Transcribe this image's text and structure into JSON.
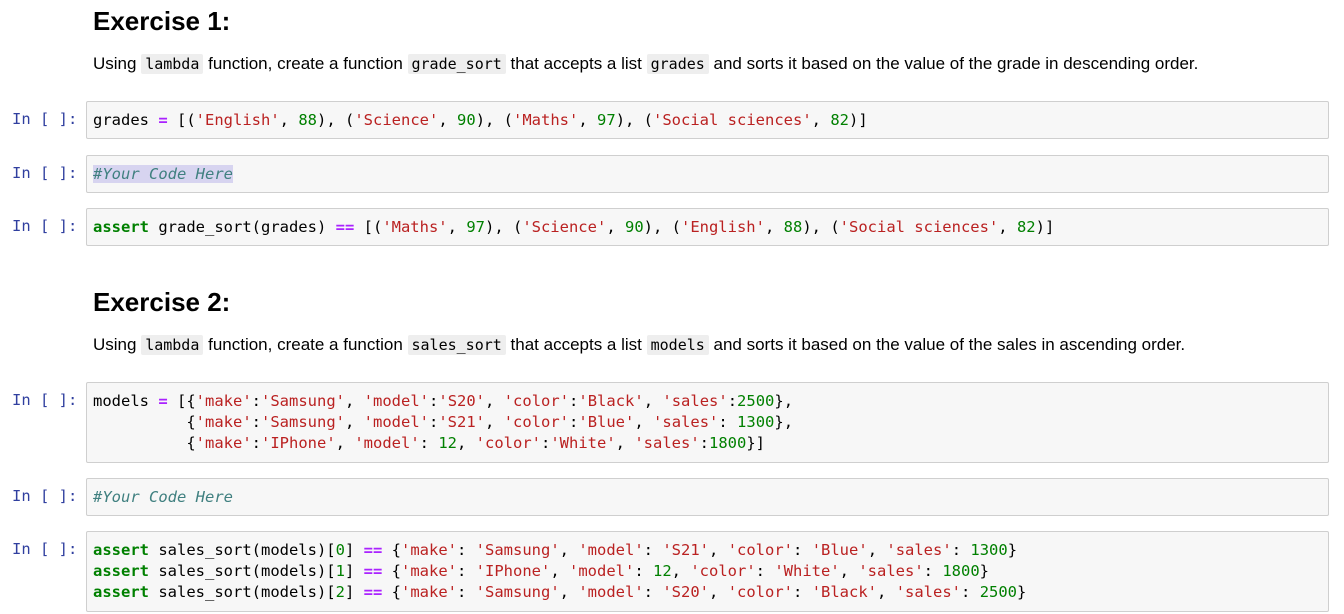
{
  "exercise1": {
    "heading": "Exercise 1:",
    "desc_a": "Using ",
    "desc_code1": "lambda",
    "desc_b": " function, create a function ",
    "desc_code2": "grade_sort",
    "desc_c": " that accepts a list ",
    "desc_code3": "grades",
    "desc_d": " and sorts it based on the value of the grade in descending order.",
    "cells": [
      {
        "prompt": "In [ ]:",
        "lines": [
          [
            [
              "t",
              "grades "
            ],
            [
              "op",
              "="
            ],
            [
              "t",
              " [("
            ],
            [
              "str",
              "'English'"
            ],
            [
              "t",
              ", "
            ],
            [
              "num",
              "88"
            ],
            [
              "t",
              "), ("
            ],
            [
              "str",
              "'Science'"
            ],
            [
              "t",
              ", "
            ],
            [
              "num",
              "90"
            ],
            [
              "t",
              "), ("
            ],
            [
              "str",
              "'Maths'"
            ],
            [
              "t",
              ", "
            ],
            [
              "num",
              "97"
            ],
            [
              "t",
              "), ("
            ],
            [
              "str",
              "'Social sciences'"
            ],
            [
              "t",
              ", "
            ],
            [
              "num",
              "82"
            ],
            [
              "t",
              ")]"
            ]
          ]
        ]
      },
      {
        "prompt": "In [ ]:",
        "lines": [
          [
            [
              "comsel",
              "#Your Code Here"
            ]
          ]
        ]
      },
      {
        "prompt": "In [ ]:",
        "lines": [
          [
            [
              "kw",
              "assert"
            ],
            [
              "t",
              " grade_sort(grades) "
            ],
            [
              "op",
              "=="
            ],
            [
              "t",
              " [("
            ],
            [
              "str",
              "'Maths'"
            ],
            [
              "t",
              ", "
            ],
            [
              "num",
              "97"
            ],
            [
              "t",
              "), ("
            ],
            [
              "str",
              "'Science'"
            ],
            [
              "t",
              ", "
            ],
            [
              "num",
              "90"
            ],
            [
              "t",
              "), ("
            ],
            [
              "str",
              "'English'"
            ],
            [
              "t",
              ", "
            ],
            [
              "num",
              "88"
            ],
            [
              "t",
              "), ("
            ],
            [
              "str",
              "'Social sciences'"
            ],
            [
              "t",
              ", "
            ],
            [
              "num",
              "82"
            ],
            [
              "t",
              ")]"
            ]
          ]
        ]
      }
    ]
  },
  "exercise2": {
    "heading": "Exercise 2:",
    "desc_a": "Using ",
    "desc_code1": "lambda",
    "desc_b": " function, create a function ",
    "desc_code2": "sales_sort",
    "desc_c": " that accepts a list ",
    "desc_code3": "models",
    "desc_d": " and sorts it based on the value of the sales in ascending order.",
    "cells": [
      {
        "prompt": "In [ ]:",
        "lines": [
          [
            [
              "t",
              "models "
            ],
            [
              "op",
              "="
            ],
            [
              "t",
              " [{"
            ],
            [
              "str",
              "'make'"
            ],
            [
              "t",
              ":"
            ],
            [
              "str",
              "'Samsung'"
            ],
            [
              "t",
              ", "
            ],
            [
              "str",
              "'model'"
            ],
            [
              "t",
              ":"
            ],
            [
              "str",
              "'S20'"
            ],
            [
              "t",
              ", "
            ],
            [
              "str",
              "'color'"
            ],
            [
              "t",
              ":"
            ],
            [
              "str",
              "'Black'"
            ],
            [
              "t",
              ", "
            ],
            [
              "str",
              "'sales'"
            ],
            [
              "t",
              ":"
            ],
            [
              "num",
              "2500"
            ],
            [
              "t",
              "},"
            ]
          ],
          [
            [
              "t",
              "          {"
            ],
            [
              "str",
              "'make'"
            ],
            [
              "t",
              ":"
            ],
            [
              "str",
              "'Samsung'"
            ],
            [
              "t",
              ", "
            ],
            [
              "str",
              "'model'"
            ],
            [
              "t",
              ":"
            ],
            [
              "str",
              "'S21'"
            ],
            [
              "t",
              ", "
            ],
            [
              "str",
              "'color'"
            ],
            [
              "t",
              ":"
            ],
            [
              "str",
              "'Blue'"
            ],
            [
              "t",
              ", "
            ],
            [
              "str",
              "'sales'"
            ],
            [
              "t",
              ": "
            ],
            [
              "num",
              "1300"
            ],
            [
              "t",
              "},"
            ]
          ],
          [
            [
              "t",
              "          {"
            ],
            [
              "str",
              "'make'"
            ],
            [
              "t",
              ":"
            ],
            [
              "str",
              "'IPhone'"
            ],
            [
              "t",
              ", "
            ],
            [
              "str",
              "'model'"
            ],
            [
              "t",
              ": "
            ],
            [
              "num",
              "12"
            ],
            [
              "t",
              ", "
            ],
            [
              "str",
              "'color'"
            ],
            [
              "t",
              ":"
            ],
            [
              "str",
              "'White'"
            ],
            [
              "t",
              ", "
            ],
            [
              "str",
              "'sales'"
            ],
            [
              "t",
              ":"
            ],
            [
              "num",
              "1800"
            ],
            [
              "t",
              "}]"
            ]
          ]
        ]
      },
      {
        "prompt": "In [ ]:",
        "lines": [
          [
            [
              "com",
              "#Your Code Here"
            ]
          ]
        ]
      },
      {
        "prompt": "In [ ]:",
        "lines": [
          [
            [
              "kw",
              "assert"
            ],
            [
              "t",
              " sales_sort(models)["
            ],
            [
              "num",
              "0"
            ],
            [
              "t",
              "] "
            ],
            [
              "op",
              "=="
            ],
            [
              "t",
              " {"
            ],
            [
              "str",
              "'make'"
            ],
            [
              "t",
              ": "
            ],
            [
              "str",
              "'Samsung'"
            ],
            [
              "t",
              ", "
            ],
            [
              "str",
              "'model'"
            ],
            [
              "t",
              ": "
            ],
            [
              "str",
              "'S21'"
            ],
            [
              "t",
              ", "
            ],
            [
              "str",
              "'color'"
            ],
            [
              "t",
              ": "
            ],
            [
              "str",
              "'Blue'"
            ],
            [
              "t",
              ", "
            ],
            [
              "str",
              "'sales'"
            ],
            [
              "t",
              ": "
            ],
            [
              "num",
              "1300"
            ],
            [
              "t",
              "}"
            ]
          ],
          [
            [
              "kw",
              "assert"
            ],
            [
              "t",
              " sales_sort(models)["
            ],
            [
              "num",
              "1"
            ],
            [
              "t",
              "] "
            ],
            [
              "op",
              "=="
            ],
            [
              "t",
              " {"
            ],
            [
              "str",
              "'make'"
            ],
            [
              "t",
              ": "
            ],
            [
              "str",
              "'IPhone'"
            ],
            [
              "t",
              ", "
            ],
            [
              "str",
              "'model'"
            ],
            [
              "t",
              ": "
            ],
            [
              "num",
              "12"
            ],
            [
              "t",
              ", "
            ],
            [
              "str",
              "'color'"
            ],
            [
              "t",
              ": "
            ],
            [
              "str",
              "'White'"
            ],
            [
              "t",
              ", "
            ],
            [
              "str",
              "'sales'"
            ],
            [
              "t",
              ": "
            ],
            [
              "num",
              "1800"
            ],
            [
              "t",
              "}"
            ]
          ],
          [
            [
              "kw",
              "assert"
            ],
            [
              "t",
              " sales_sort(models)["
            ],
            [
              "num",
              "2"
            ],
            [
              "t",
              "] "
            ],
            [
              "op",
              "=="
            ],
            [
              "t",
              " {"
            ],
            [
              "str",
              "'make'"
            ],
            [
              "t",
              ": "
            ],
            [
              "str",
              "'Samsung'"
            ],
            [
              "t",
              ", "
            ],
            [
              "str",
              "'model'"
            ],
            [
              "t",
              ": "
            ],
            [
              "str",
              "'S20'"
            ],
            [
              "t",
              ", "
            ],
            [
              "str",
              "'color'"
            ],
            [
              "t",
              ": "
            ],
            [
              "str",
              "'Black'"
            ],
            [
              "t",
              ", "
            ],
            [
              "str",
              "'sales'"
            ],
            [
              "t",
              ": "
            ],
            [
              "num",
              "2500"
            ],
            [
              "t",
              "}"
            ]
          ]
        ]
      }
    ]
  }
}
